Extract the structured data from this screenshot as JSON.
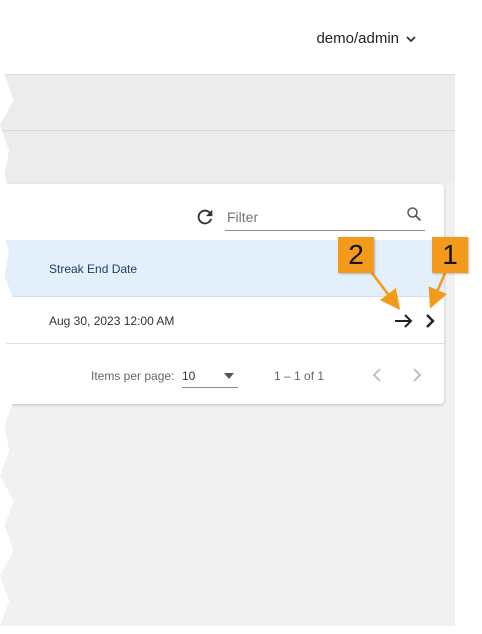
{
  "header": {
    "user_label": "demo/admin"
  },
  "toolbar": {
    "filter_placeholder": "Filter"
  },
  "table": {
    "columns": [
      "Streak End Date"
    ],
    "rows": [
      [
        "Aug 30, 2023 12:00 AM"
      ]
    ]
  },
  "pagination": {
    "items_per_page_label": "Items per page:",
    "items_per_page_value": "10",
    "range_label": "1 – 1 of 1"
  },
  "callouts": [
    "2",
    "1"
  ],
  "colors": {
    "callout": "#f39a1a",
    "header_row": "#e3effb"
  }
}
